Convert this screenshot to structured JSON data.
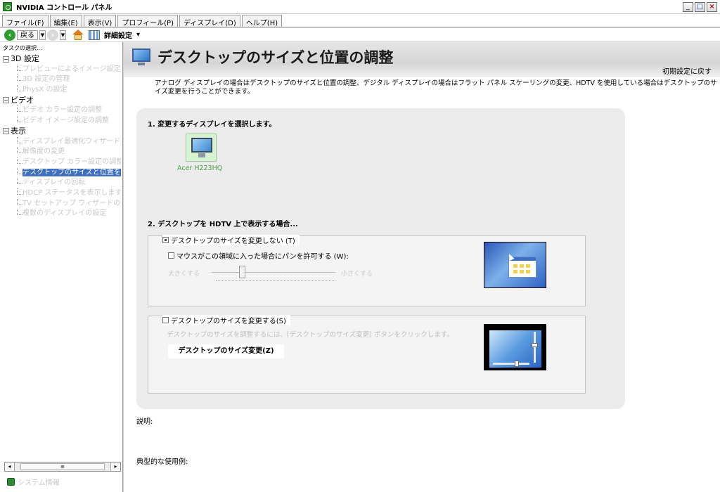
{
  "window": {
    "title": "NVIDIA コントロール パネル",
    "controls": [
      "_",
      "□",
      "×"
    ]
  },
  "menu": [
    "ファイル(F)",
    "編集(E)",
    "表示(V)",
    "プロフィール(P)",
    "ディスプレイ(D)",
    "ヘルプ(H)"
  ],
  "toolbar": {
    "back_label": "戻る",
    "advanced_label": "詳細設定"
  },
  "sidebar": {
    "header": "タスクの選択...",
    "groups": [
      {
        "label": "3D 設定",
        "items": [
          "プレビューによるイメージ設定の",
          "3D 設定の管理",
          "PhysX の設定"
        ]
      },
      {
        "label": "ビデオ",
        "items": [
          "ビデオ カラー設定の調整",
          "ビデオ イメージ設定の調整"
        ]
      },
      {
        "label": "表示",
        "items": [
          "ディスプレイ最適化ウィザードの",
          "解像度の変更",
          "デスクトップ カラー設定の調整",
          "デスクトップのサイズと位置を変",
          "ディスプレイの回転",
          "HDCP ステータスを表示します。",
          "TV セットアップ ウィザードの実",
          "複数のディスプレイの設定"
        ]
      }
    ],
    "selected": "デスクトップのサイズと位置を変",
    "system_info": "システム情報"
  },
  "page": {
    "title": "デスクトップのサイズと位置の調整",
    "restore_link": "初期設定に戻す",
    "description": "アナログ ディスプレイの場合はデスクトップのサイズと位置の調整、デジタル ディスプレイの場合はフラット パネル スケーリングの変更、HDTV を使用している場合はデスクトップのサイズ変更を行うことができます。",
    "section1_title": "1. 変更するディスプレイを選択します。",
    "display_name": "Acer H223HQ",
    "section2_title": "2. デスクトップを HDTV 上で表示する場合...",
    "option_no_resize": "デスクトップのサイズを変更しない (T)",
    "option_pan": "マウスがこの領域に入った場合にパンを許可する (W):",
    "slider_left": "大きくする",
    "slider_right": "小さくする",
    "option_resize": "デスクトップのサイズを変更する(S)",
    "resize_hint": "デスクトップのサイズを調整するには、[デスクトップのサイズ変更] ボタンをクリックします。",
    "resize_button": "デスクトップのサイズ変更(Z)",
    "description_label": "説明:",
    "usage_label": "典型的な使用例:"
  }
}
